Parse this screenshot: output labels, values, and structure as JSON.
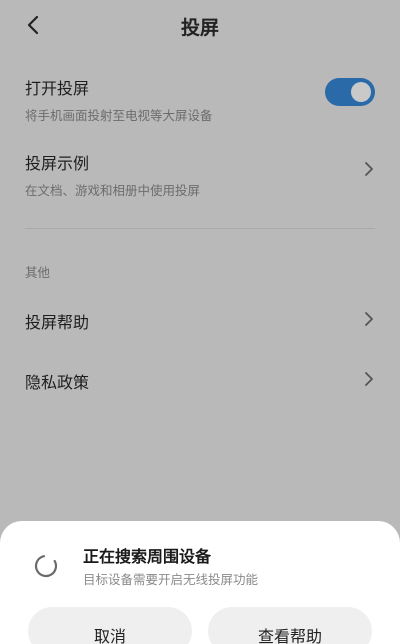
{
  "header": {
    "title": "投屏"
  },
  "settings": {
    "cast_toggle": {
      "title": "打开投屏",
      "subtitle": "将手机画面投射至电视等大屏设备",
      "enabled": true,
      "accent": "#2a6aa8"
    },
    "cast_example": {
      "title": "投屏示例",
      "subtitle": "在文档、游戏和相册中使用投屏"
    }
  },
  "other": {
    "label": "其他",
    "items": [
      {
        "title": "投屏帮助"
      },
      {
        "title": "隐私政策"
      }
    ]
  },
  "dialog": {
    "title": "正在搜索周围设备",
    "subtitle": "目标设备需要开启无线投屏功能",
    "cancel_label": "取消",
    "help_label": "查看帮助"
  },
  "icons": [
    "back-arrow-icon",
    "chevron-right-icon",
    "loading-spinner-icon"
  ]
}
